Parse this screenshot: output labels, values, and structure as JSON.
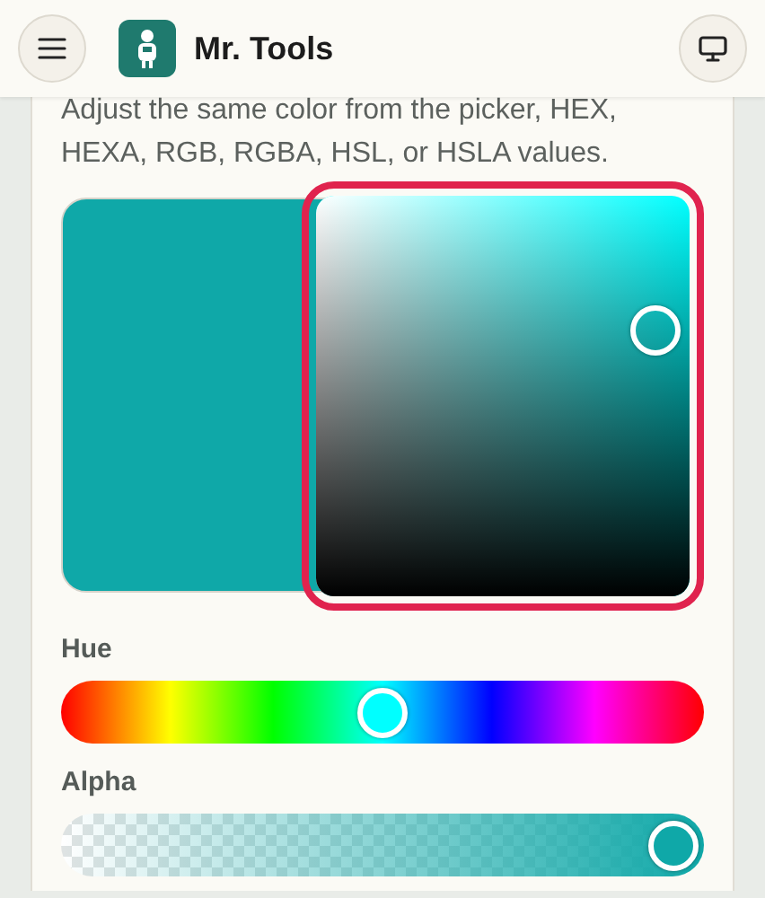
{
  "header": {
    "title": "Mr. Tools"
  },
  "intro": "Adjust the same color from the picker, HEX, HEXA, RGB, RGBA, HSL, or HSLA values.",
  "picker": {
    "focused": true
  },
  "hue": {
    "label": "Hue",
    "level": 0.5
  },
  "alpha": {
    "label": "Alpha",
    "level": 1
  }
}
